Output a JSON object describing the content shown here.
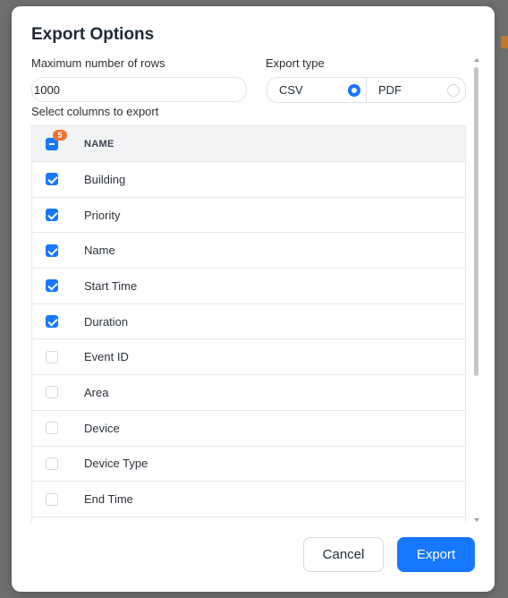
{
  "modal": {
    "title": "Export Options",
    "max_rows_label": "Maximum number of rows",
    "max_rows_value": "1000",
    "export_type_label": "Export type",
    "export_types": [
      {
        "label": "CSV",
        "selected": true
      },
      {
        "label": "PDF",
        "selected": false
      }
    ],
    "columns_label": "Select columns to export",
    "table": {
      "header": "NAME",
      "selected_count": "5",
      "rows": [
        {
          "label": "Building",
          "checked": true
        },
        {
          "label": "Priority",
          "checked": true
        },
        {
          "label": "Name",
          "checked": true
        },
        {
          "label": "Start Time",
          "checked": true
        },
        {
          "label": "Duration",
          "checked": true
        },
        {
          "label": "Event ID",
          "checked": false
        },
        {
          "label": "Area",
          "checked": false
        },
        {
          "label": "Device",
          "checked": false
        },
        {
          "label": "Device Type",
          "checked": false
        },
        {
          "label": "End Time",
          "checked": false
        },
        {
          "label": "",
          "checked": false
        }
      ]
    },
    "cancel_label": "Cancel",
    "export_label": "Export"
  },
  "colors": {
    "accent": "#1677ff",
    "badge": "#f0722c"
  }
}
